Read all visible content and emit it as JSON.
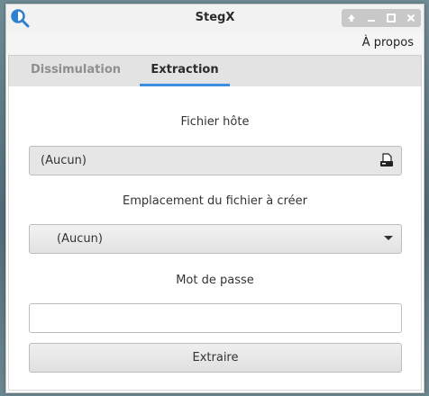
{
  "window": {
    "title": "StegX",
    "menu_apropos": "À propos"
  },
  "tabs": [
    {
      "label": "Dissimulation",
      "active": false
    },
    {
      "label": "Extraction",
      "active": true
    }
  ],
  "extraction": {
    "host_file_label": "Fichier hôte",
    "host_file_value": "(Aucun)",
    "output_location_label": "Emplacement du fichier à créer",
    "output_location_value": "(Aucun)",
    "password_label": "Mot de passe",
    "password_value": "",
    "extract_button": "Extraire"
  },
  "colors": {
    "active_tab_underline": "#3d8ee0"
  }
}
